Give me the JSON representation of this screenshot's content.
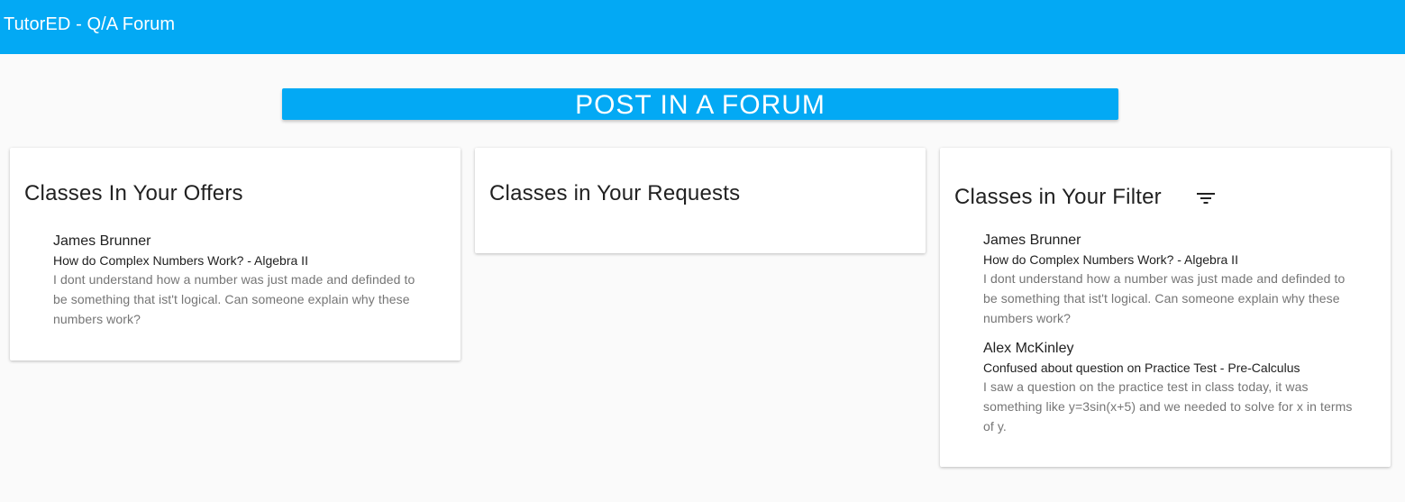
{
  "app": {
    "title": "TutorED - Q/A Forum"
  },
  "actions": {
    "post_label": "POST IN A FORUM"
  },
  "cards": {
    "offers": {
      "title": "Classes In Your Offers",
      "posts": [
        {
          "author": "James Brunner",
          "subject": "How do Complex Numbers Work? - Algebra II",
          "body": "I dont understand how a number was just made and definded to be something that ist't logical. Can someone explain why these numbers work?"
        }
      ]
    },
    "requests": {
      "title": "Classes in Your Requests",
      "posts": []
    },
    "filter": {
      "title": "Classes in Your Filter",
      "icon": "filter-icon",
      "posts": [
        {
          "author": "James Brunner",
          "subject": "How do Complex Numbers Work? - Algebra II",
          "body": "I dont understand how a number was just made and definded to be something that ist't logical. Can someone explain why these numbers work?"
        },
        {
          "author": "Alex McKinley",
          "subject": "Confused about question on Practice Test - Pre-Calculus",
          "body": "I saw a question on the practice test in class today, it was something like y=3sin(x+5) and we needed to solve for x in terms of y."
        }
      ]
    }
  },
  "colors": {
    "primary": "#03a9f4",
    "background": "#fafafa",
    "secondary_text": "#757575"
  }
}
